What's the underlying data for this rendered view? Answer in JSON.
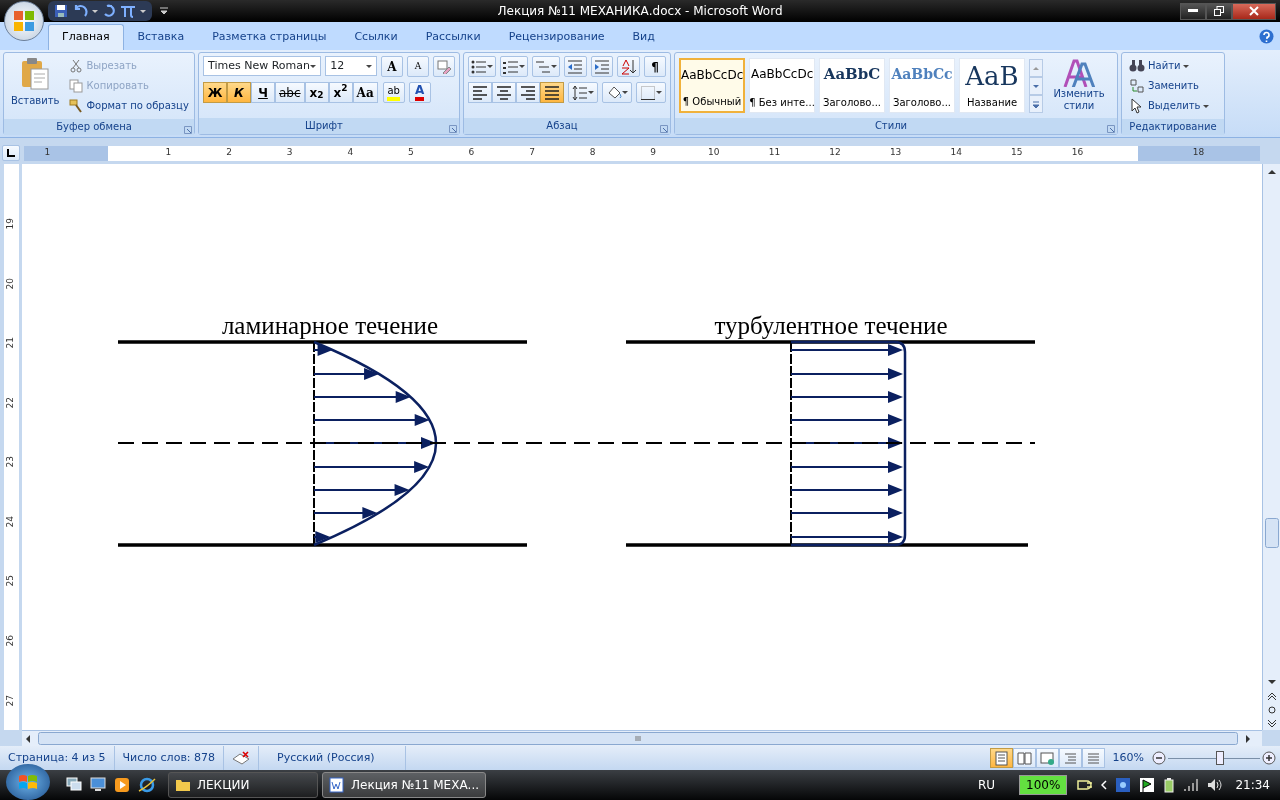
{
  "window": {
    "title": "Лекция №11 МЕХАНИКА.docx - Microsoft Word"
  },
  "ribbon_tabs": [
    {
      "label": "Главная",
      "selected": true
    },
    {
      "label": "Вставка",
      "selected": false
    },
    {
      "label": "Разметка страницы",
      "selected": false
    },
    {
      "label": "Ссылки",
      "selected": false
    },
    {
      "label": "Рассылки",
      "selected": false
    },
    {
      "label": "Рецензирование",
      "selected": false
    },
    {
      "label": "Вид",
      "selected": false
    }
  ],
  "clipboard": {
    "paste": "Вставить",
    "tools": [
      {
        "label": "Вырезать",
        "kind": "cut",
        "disabled": true
      },
      {
        "label": "Копировать",
        "kind": "copy",
        "disabled": true
      },
      {
        "label": "Формат по образцу",
        "kind": "painter",
        "disabled": false
      }
    ],
    "group_label": "Буфер обмена"
  },
  "font": {
    "font_name": "Times New Roman",
    "font_size": "12",
    "grow": "A",
    "shrink": "A",
    "format_buttons": [
      {
        "label": "Ж",
        "kind": "bold",
        "selected": true
      },
      {
        "label": "К",
        "kind": "italic",
        "selected": true
      },
      {
        "label": "Ч",
        "kind": "underline",
        "selected": false
      },
      {
        "label": "abc",
        "kind": "strike",
        "selected": false
      },
      {
        "label": "x$_{2}$",
        "kind": "sub",
        "selected": false
      },
      {
        "label": "x$^{2}$",
        "kind": "sup",
        "selected": false
      },
      {
        "label": "Aa",
        "kind": "case",
        "selected": false
      }
    ],
    "highlight": "ab",
    "font_color": "A",
    "group_label": "Шрифт"
  },
  "paragraph": {
    "show_marks": "¶",
    "alignments": [
      {
        "kind": "left",
        "selected": false
      },
      {
        "kind": "center",
        "selected": false
      },
      {
        "kind": "right",
        "selected": false
      },
      {
        "kind": "justify",
        "selected": true
      }
    ],
    "group_label": "Абзац"
  },
  "styles": {
    "items": [
      {
        "preview": "AaBbCcDc",
        "name": "¶ Обычный",
        "kind": "normal",
        "selected": true
      },
      {
        "preview": "AaBbCcDc",
        "name": "¶ Без инте...",
        "kind": "normal",
        "selected": false
      },
      {
        "preview": "AaBbC",
        "name": "Заголово...",
        "kind": "heading1",
        "selected": false
      },
      {
        "preview": "AaBbCc",
        "name": "Заголово...",
        "kind": "heading2",
        "selected": false
      },
      {
        "preview": "AaB",
        "name": "Название",
        "kind": "title",
        "selected": false
      }
    ],
    "change_styles": "Изменить стили",
    "group_label": "Стили"
  },
  "editing": {
    "items": [
      {
        "label": "Найти",
        "kind": "find"
      },
      {
        "label": "Заменить",
        "kind": "replace"
      },
      {
        "label": "Выделить",
        "kind": "select"
      }
    ],
    "group_label": "Редактирование"
  },
  "ruler": {
    "labels": [
      "1",
      "1",
      "2",
      "3",
      "4",
      "5",
      "6",
      "7",
      "8",
      "9",
      "10",
      "11",
      "12",
      "13",
      "14",
      "15",
      "16",
      "18"
    ]
  },
  "vertical_ruler": {
    "labels": [
      "19",
      "20",
      "21",
      "22",
      "23",
      "24",
      "25",
      "26",
      "27"
    ]
  },
  "document": {
    "laminar_label": "ламинарное течение",
    "turbulent_label": "турбулентное течение"
  },
  "status_bar": {
    "page": "Страница: 4 из 5",
    "words": "Число слов: 878",
    "language": "Русский (Россия)",
    "views": [
      {
        "kind": "print",
        "selected": true
      },
      {
        "kind": "reading",
        "selected": false
      },
      {
        "kind": "web",
        "selected": false
      },
      {
        "kind": "outline",
        "selected": false
      },
      {
        "kind": "draft",
        "selected": false
      }
    ],
    "zoom": "160%",
    "zoom_slider": {
      "level": 0.57
    }
  },
  "taskbar": {
    "items": [
      {
        "label": "ЛЕКЦИИ",
        "kind": "folder",
        "selected": false
      },
      {
        "label": "Лекция №11 МЕХА...",
        "kind": "word",
        "selected": true
      }
    ],
    "language": "RU",
    "battery": "100%",
    "clock": "21:34"
  }
}
